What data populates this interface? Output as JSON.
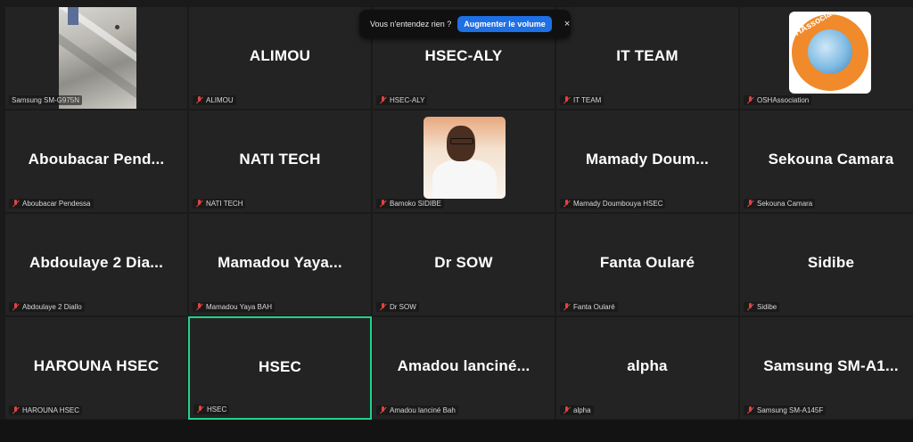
{
  "banner": {
    "message": "Vous n'entendez rien ?",
    "action_label": "Augmenter le volume",
    "close_symbol": "×"
  },
  "tiles": [
    {
      "display_name": "",
      "label": "Samsung SM-G975N",
      "type": "video"
    },
    {
      "display_name": "ALIMOU",
      "label": "ALIMOU",
      "type": "name"
    },
    {
      "display_name": "HSEC-ALY",
      "label": "HSEC-ALY",
      "type": "name"
    },
    {
      "display_name": "IT TEAM",
      "label": "IT TEAM",
      "type": "name"
    },
    {
      "display_name": "",
      "label": "OSHAssociation",
      "type": "logo",
      "logo_text": "OSHAssociation"
    },
    {
      "display_name": "Aboubacar  Pend...",
      "label": "Aboubacar Pendessa",
      "type": "name"
    },
    {
      "display_name": "NATI TECH",
      "label": "NATI TECH",
      "type": "name"
    },
    {
      "display_name": "",
      "label": "Bamoko SIDIBE",
      "type": "photo"
    },
    {
      "display_name": "Mamady  Doum...",
      "label": "Mamady Doumbouya HSEC",
      "type": "name"
    },
    {
      "display_name": "Sekouna Camara",
      "label": "Sekouna Camara",
      "type": "name"
    },
    {
      "display_name": "Abdoulaye 2 Dia...",
      "label": "Abdoulaye 2 Diallo",
      "type": "name"
    },
    {
      "display_name": "Mamadou  Yaya...",
      "label": "Mamadou Yaya BAH",
      "type": "name"
    },
    {
      "display_name": "Dr SOW",
      "label": "Dr SOW",
      "type": "name"
    },
    {
      "display_name": "Fanta Oularé",
      "label": "Fanta Oularé",
      "type": "name"
    },
    {
      "display_name": "Sidibe",
      "label": "Sidibe",
      "type": "name"
    },
    {
      "display_name": "HAROUNA HSEC",
      "label": "HAROUNA HSEC",
      "type": "name"
    },
    {
      "display_name": "HSEC",
      "label": "HSEC",
      "type": "name",
      "active": true
    },
    {
      "display_name": "Amadou  lanciné...",
      "label": "Amadou lanciné Bah",
      "type": "name"
    },
    {
      "display_name": "alpha",
      "label": "alpha",
      "type": "name"
    },
    {
      "display_name": "Samsung  SM-A1...",
      "label": "Samsung SM-A145F",
      "type": "name"
    }
  ],
  "colors": {
    "active_border": "#23d18b",
    "mic_muted": "#e0443e",
    "banner_button": "#1f6fe5"
  },
  "icons": {
    "muted": "mic-off-icon",
    "close": "close-icon"
  }
}
